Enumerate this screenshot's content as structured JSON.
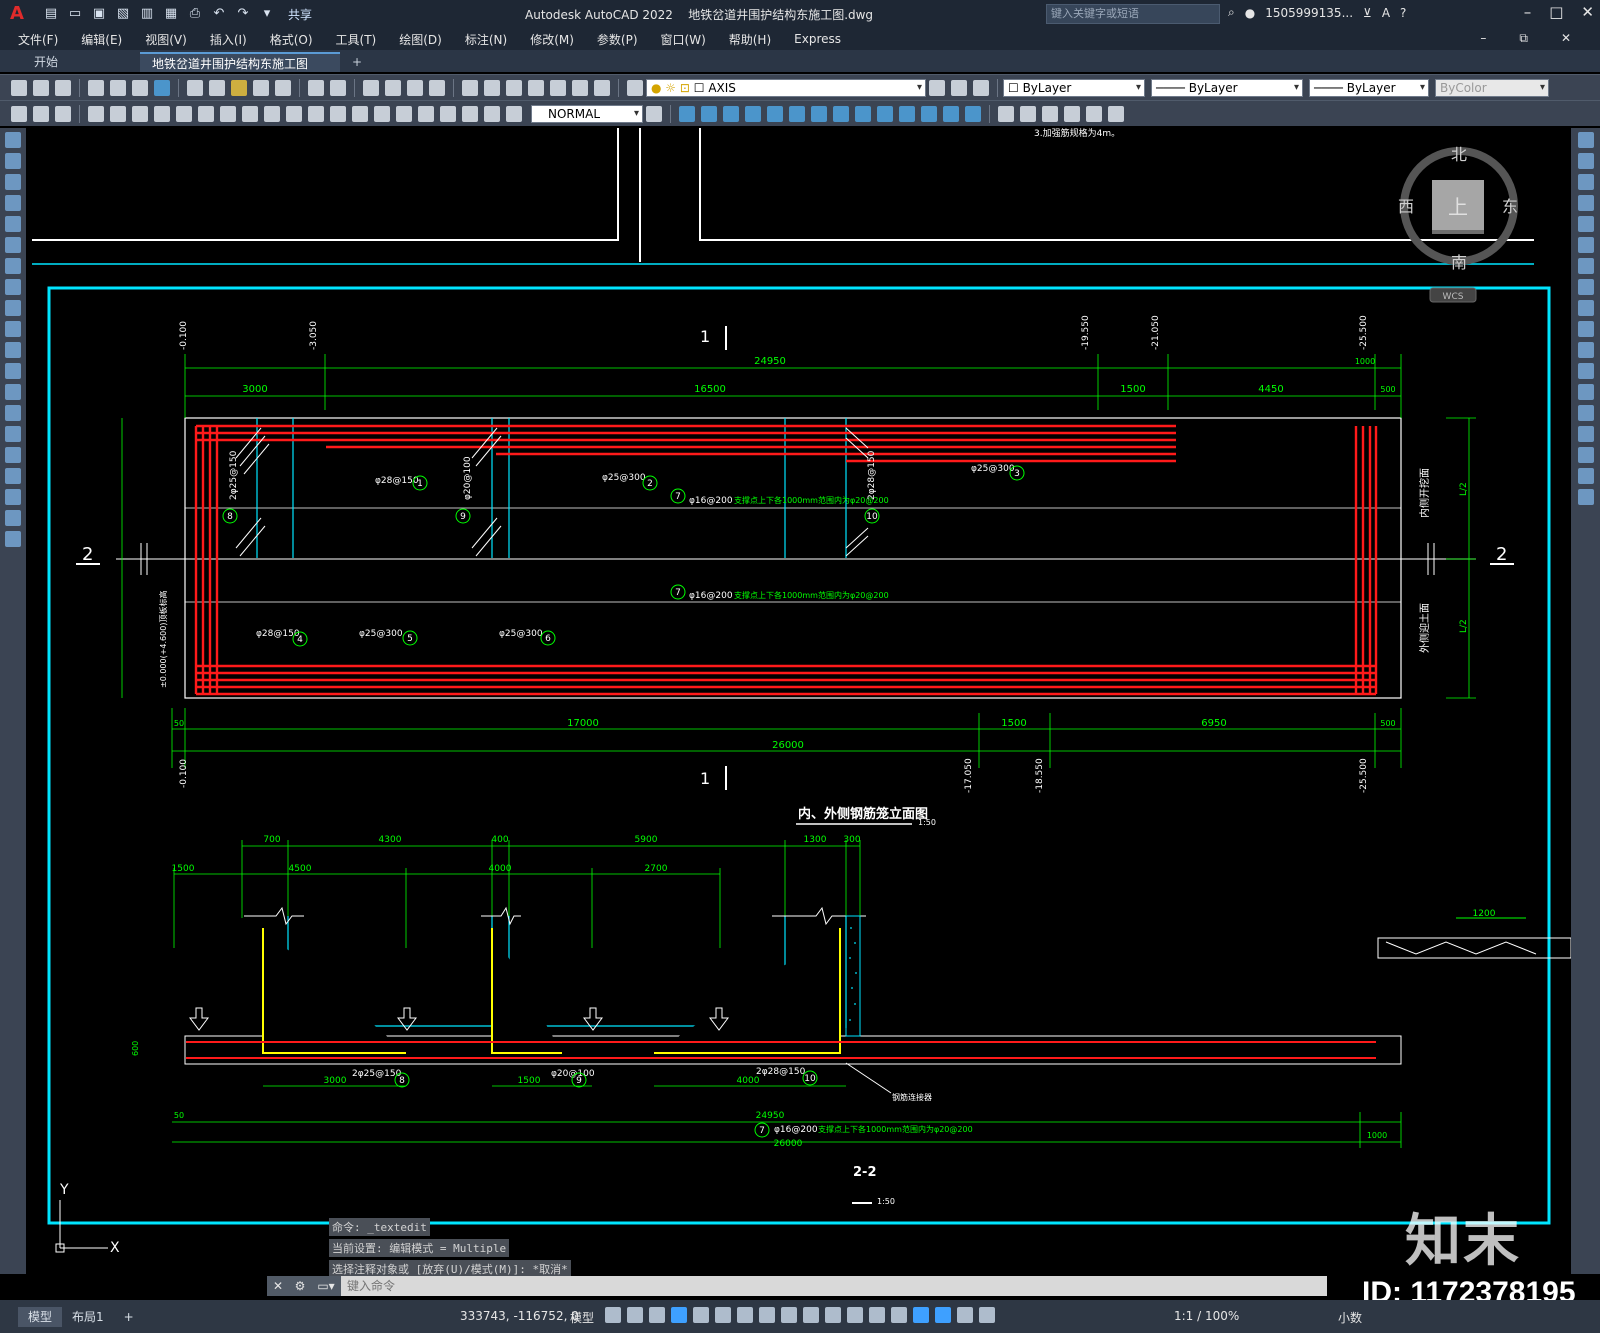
{
  "app": {
    "product": "Autodesk AutoCAD 2022",
    "file": "地铁岔道井围护结构东施工图.dwg",
    "share_label": "共享",
    "search_placeholder": "键入关键字或短语",
    "user": "1505999135...",
    "brand_color": "#e02b2b"
  },
  "menu": [
    "文件(F)",
    "编辑(E)",
    "视图(V)",
    "插入(I)",
    "格式(O)",
    "工具(T)",
    "绘图(D)",
    "标注(N)",
    "修改(M)",
    "参数(P)",
    "窗口(W)",
    "帮助(H)",
    "Express"
  ],
  "tabs": {
    "start": "开始",
    "active": "地铁岔道井围护结构东施工图*",
    "add": "+"
  },
  "toolbar": {
    "layer": "AXIS",
    "color": "ByLayer",
    "linetype": "ByLayer",
    "lineweight": "ByLayer",
    "plotstyle": "ByColor",
    "dimstyle": "NORMAL"
  },
  "viewcube": {
    "north": "北",
    "south": "南",
    "east": "东",
    "west": "西",
    "top": "上",
    "wcs": "WCS"
  },
  "drawing": {
    "note_top": "3.加强筋规格为4m。",
    "section_11": "1",
    "section_22": "2",
    "elev_title": "内、外侧钢筋笼立面图",
    "elev_scale": "1:50",
    "sec22_title": "2-2",
    "sec22_scale": "1:50",
    "dims_top": {
      "total": "24950",
      "d1": "3000",
      "d2": "16500",
      "d3": "1500",
      "d4": "4450",
      "d5": "1000",
      "d6": "500",
      "lv1": "-0.100",
      "lv2": "-3.050",
      "lv3": "-19.550",
      "lv4": "-21.050",
      "lv5": "-25.500"
    },
    "dims_bottom": {
      "total": "26000",
      "d0": "50",
      "d1": "17000",
      "d2": "1500",
      "d3": "6950",
      "d4": "500",
      "lv1": "-0.100",
      "lv2": "-17.050",
      "lv3": "-18.550",
      "lv4": "-25.500"
    },
    "rebar_labels": {
      "r1": "φ28@150",
      "r2": "φ25@300",
      "r3": "φ25@300",
      "r4": "φ28@150",
      "r5": "φ25@300",
      "r6": "φ25@300",
      "r7": "φ16@200",
      "r7_note": "支撑点上下各1000mm范围内为φ20@200",
      "r8": "2φ25@150",
      "r9": "φ20@100",
      "r10": "2φ28@150",
      "side_top": "内侧开挖面",
      "side_bottom": "外侧迎土面",
      "l2": "L/2",
      "elev_left": "±0.000(+4.600)顶板标高"
    },
    "sec_dims": {
      "a1": "700",
      "a2": "4300",
      "a3": "400",
      "a4": "5900",
      "a5": "1300",
      "a6": "300",
      "b1": "1500",
      "b2": "4500",
      "b3": "4000",
      "b4": "2700",
      "c1": "3000",
      "c2": "1500",
      "c3": "4000",
      "h": "600",
      "total1": "24950",
      "total2": "26000",
      "end": "1000",
      "end2": "50",
      "connector": "钢筋连接器",
      "right_dim": "1200"
    }
  },
  "command": {
    "history": [
      "命令: _textedit",
      "当前设置: 编辑模式 = Multiple",
      "选择注释对象或 [放弃(U)/模式(M)]: *取消*"
    ],
    "placeholder": "键入命令"
  },
  "status": {
    "tab_model": "模型",
    "tab_layout": "布局1",
    "coords": "333743, -116752, 0",
    "space": "模型",
    "scale": "1:1 / 100%",
    "units": "小数"
  },
  "watermark": {
    "logo": "知末",
    "id": "ID: 1172378195"
  },
  "colors": {
    "cyan": "#00e5ff",
    "green": "#00ff00",
    "red": "#ff1a1a",
    "yellow": "#ffff00",
    "white": "#ffffff"
  }
}
